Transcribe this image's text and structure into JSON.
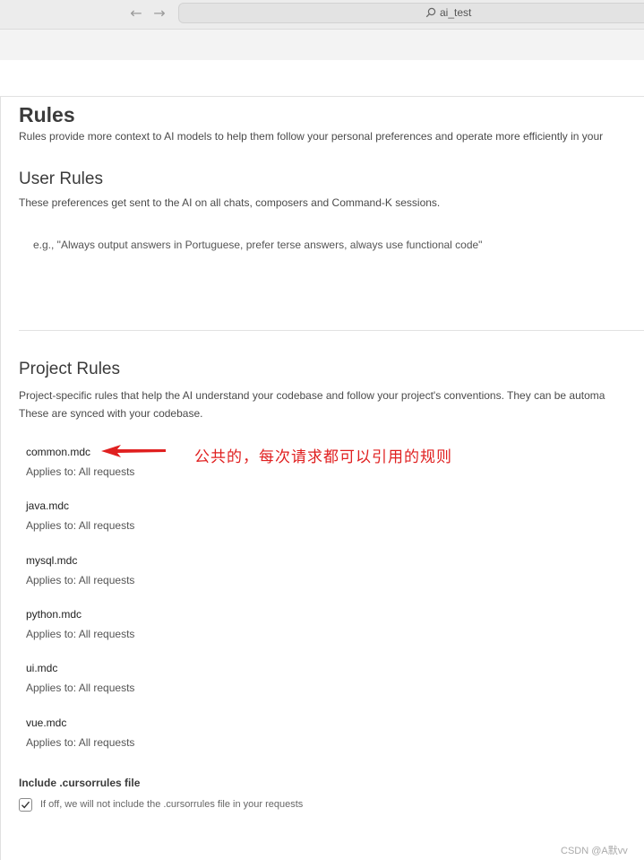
{
  "browser": {
    "back_icon": "arrow-left-icon",
    "forward_icon": "arrow-right-icon",
    "search_text": "ai_test",
    "search_icon": "search-icon"
  },
  "rules": {
    "title": "Rules",
    "description": "Rules provide more context to AI models to help them follow your personal preferences and operate more efficiently in your"
  },
  "user_rules": {
    "title": "User Rules",
    "description": "These preferences get sent to the AI on all chats, composers and Command-K sessions.",
    "placeholder": "e.g., \"Always output answers in Portuguese, prefer terse answers, always use functional code\""
  },
  "project_rules": {
    "title": "Project Rules",
    "description_line1": "Project-specific rules that help the AI understand your codebase and follow your project's conventions. They can be automa",
    "description_line2": "These are synced with your codebase.",
    "files": [
      {
        "name": "common.mdc",
        "applies": "Applies to: All requests"
      },
      {
        "name": "java.mdc",
        "applies": "Applies to: All requests"
      },
      {
        "name": "mysql.mdc",
        "applies": "Applies to: All requests"
      },
      {
        "name": "python.mdc",
        "applies": "Applies to: All requests"
      },
      {
        "name": "ui.mdc",
        "applies": "Applies to: All requests"
      },
      {
        "name": "vue.mdc",
        "applies": "Applies to: All requests"
      }
    ]
  },
  "cursorrules": {
    "title": "Include .cursorrules file",
    "checkbox_label": "If off, we will not include the .cursorrules file in your requests",
    "checked": true
  },
  "annotation": {
    "text": "公共的，每次请求都可以引用的规则",
    "color": "#e02020"
  },
  "watermark": "CSDN @A默vv"
}
